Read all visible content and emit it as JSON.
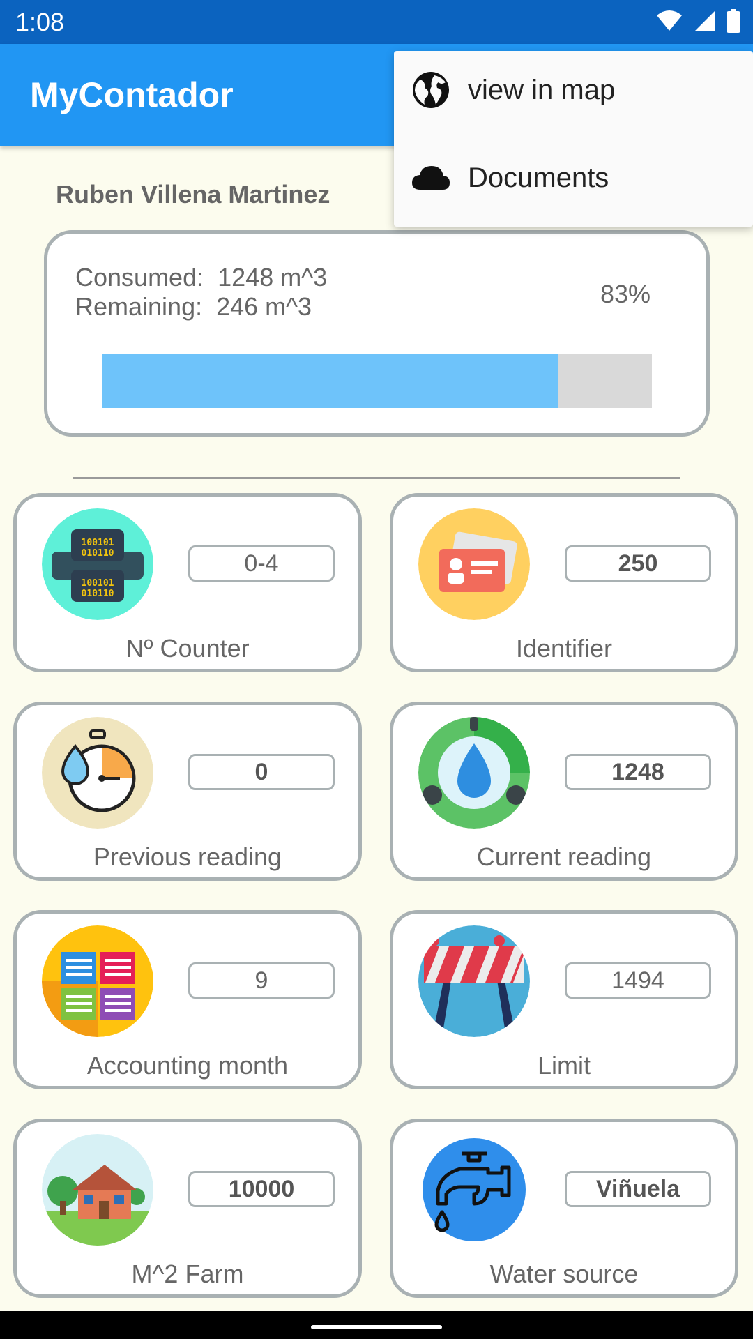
{
  "status_bar": {
    "time": "1:08",
    "icons": [
      "wifi-icon",
      "signal-icon",
      "battery-icon"
    ]
  },
  "app_bar": {
    "title": "MyContador"
  },
  "user": {
    "name": "Ruben Villena Martinez"
  },
  "usage": {
    "consumed_label": "Consumed:",
    "consumed_value": "1248 m^3",
    "remaining_label": "Remaining:",
    "remaining_value": "246 m^3",
    "percent_text": "83%",
    "percent": 83
  },
  "tiles": [
    {
      "label": "Nº Counter",
      "value": "0-4",
      "icon": "binary-counter-icon"
    },
    {
      "label": "Identifier",
      "value": "250",
      "icon": "id-card-icon"
    },
    {
      "label": "Previous reading",
      "value": "0",
      "icon": "stopwatch-water-icon"
    },
    {
      "label": "Current reading",
      "value": "1248",
      "icon": "water-drop-ring-icon"
    },
    {
      "label": "Accounting month",
      "value": "9",
      "icon": "calendar-notes-icon"
    },
    {
      "label": "Limit",
      "value": "1494",
      "icon": "roadblock-icon"
    },
    {
      "label": "M^2 Farm",
      "value": "10000",
      "icon": "farm-house-icon"
    },
    {
      "label": "Water source",
      "value": "Viñuela",
      "icon": "water-tap-icon"
    }
  ],
  "menu": {
    "items": [
      {
        "label": "view in map",
        "icon": "globe-icon"
      },
      {
        "label": "Documents",
        "icon": "cloud-icon"
      }
    ]
  },
  "colors": {
    "status_bar": "#0B63BF",
    "app_bar": "#2196F3",
    "background": "#FCFCEE",
    "progress_fill": "#6EC3FA",
    "progress_track": "#D9D9D9",
    "border": "#A9B1B3"
  }
}
